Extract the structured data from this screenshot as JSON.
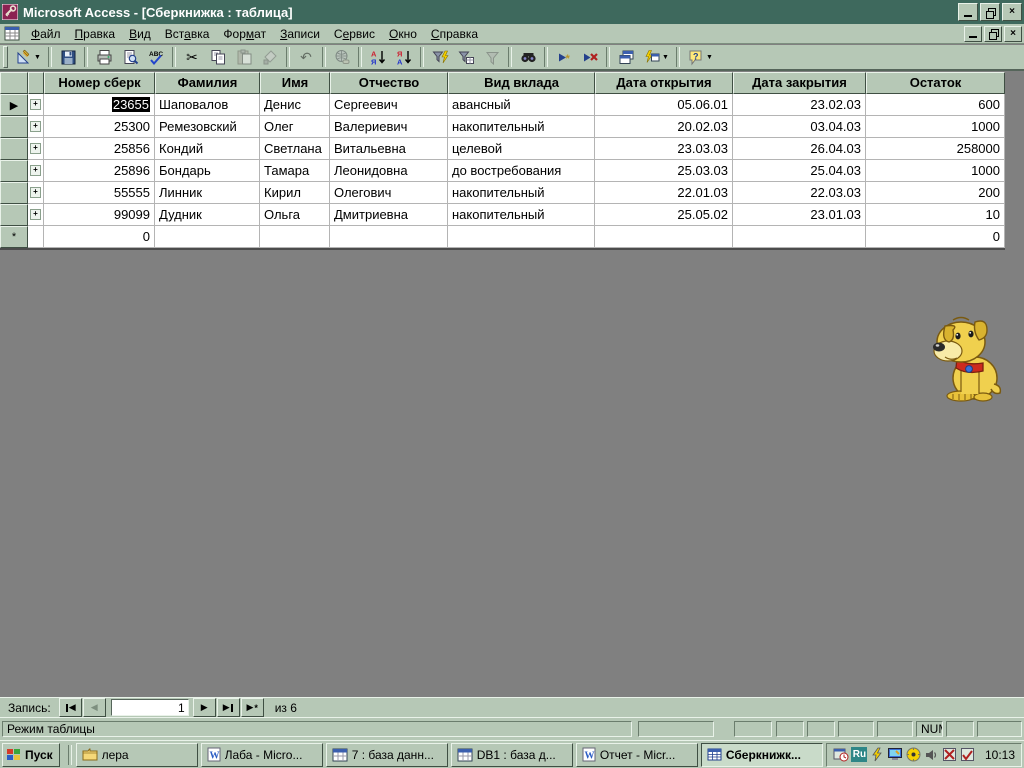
{
  "window": {
    "title": "Microsoft Access - [Сберкнижка : таблица]"
  },
  "menu": {
    "items": [
      {
        "label": "Файл",
        "u": 0
      },
      {
        "label": "Правка",
        "u": 0
      },
      {
        "label": "Вид",
        "u": 0
      },
      {
        "label": "Вставка",
        "u": 3
      },
      {
        "label": "Формат",
        "u": 3
      },
      {
        "label": "Записи",
        "u": 0
      },
      {
        "label": "Сервис",
        "u": 1
      },
      {
        "label": "Окно",
        "u": 0
      },
      {
        "label": "Справка",
        "u": 0
      }
    ]
  },
  "toolbar": {
    "buttons": [
      {
        "icon": "design-view-icon",
        "name": "view-button",
        "dropdown": true
      },
      {
        "sep": true
      },
      {
        "icon": "save-icon",
        "name": "save-button"
      },
      {
        "sep": true
      },
      {
        "icon": "print-icon",
        "name": "print-button"
      },
      {
        "icon": "print-preview-icon",
        "name": "print-preview-button"
      },
      {
        "icon": "spelling-icon",
        "name": "spelling-button"
      },
      {
        "sep": true
      },
      {
        "icon": "cut-icon",
        "name": "cut-button",
        "glyph": "✂"
      },
      {
        "icon": "copy-icon",
        "name": "copy-button"
      },
      {
        "icon": "paste-icon",
        "name": "paste-button",
        "disabled": true
      },
      {
        "icon": "format-painter-icon",
        "name": "format-painter-button",
        "disabled": true
      },
      {
        "sep": true
      },
      {
        "icon": "undo-icon",
        "name": "undo-button",
        "glyph": "↶",
        "disabled": true
      },
      {
        "sep": true
      },
      {
        "icon": "hyperlink-icon",
        "name": "insert-hyperlink-button",
        "disabled": true
      },
      {
        "sep": true
      },
      {
        "icon": "sort-asc-icon",
        "name": "sort-ascending-button"
      },
      {
        "icon": "sort-desc-icon",
        "name": "sort-descending-button"
      },
      {
        "sep": true
      },
      {
        "icon": "filter-selection-icon",
        "name": "filter-by-selection-button"
      },
      {
        "icon": "filter-form-icon",
        "name": "filter-by-form-button"
      },
      {
        "icon": "apply-filter-icon",
        "name": "apply-filter-button",
        "disabled": true
      },
      {
        "sep": true
      },
      {
        "icon": "find-icon",
        "name": "find-button"
      },
      {
        "sep": true
      },
      {
        "icon": "new-record-icon",
        "name": "new-record-button"
      },
      {
        "icon": "delete-record-icon",
        "name": "delete-record-button"
      },
      {
        "sep": true
      },
      {
        "icon": "database-window-icon",
        "name": "database-window-button"
      },
      {
        "icon": "new-object-icon",
        "name": "new-object-button",
        "dropdown": true
      },
      {
        "sep": true
      },
      {
        "icon": "help-icon",
        "name": "help-button",
        "dropdown": true
      }
    ]
  },
  "table": {
    "columns": [
      {
        "key": "num",
        "label": "Номер сберк",
        "align": "right"
      },
      {
        "key": "last",
        "label": "Фамилия",
        "align": "left"
      },
      {
        "key": "first",
        "label": "Имя",
        "align": "left"
      },
      {
        "key": "mid",
        "label": "Отчество",
        "align": "left"
      },
      {
        "key": "type",
        "label": "Вид вклада",
        "align": "left"
      },
      {
        "key": "open",
        "label": "Дата открытия",
        "align": "right"
      },
      {
        "key": "close",
        "label": "Дата закрытия",
        "align": "right"
      },
      {
        "key": "bal",
        "label": "Остаток",
        "align": "right"
      }
    ],
    "rows": [
      {
        "num": "23655",
        "last": "Шаповалов",
        "first": "Денис",
        "mid": "Сергеевич",
        "type": "авансный",
        "open": "05.06.01",
        "close": "23.02.03",
        "bal": "600",
        "current": true,
        "selected_cell": "num"
      },
      {
        "num": "25300",
        "last": "Ремезовский",
        "first": "Олег",
        "mid": "Валериевич",
        "type": "накопительный",
        "open": "20.02.03",
        "close": "03.04.03",
        "bal": "1000"
      },
      {
        "num": "25856",
        "last": "Кондий",
        "first": "Светлана",
        "mid": "Витальевна",
        "type": "целевой",
        "open": "23.03.03",
        "close": "26.04.03",
        "bal": "258000"
      },
      {
        "num": "25896",
        "last": "Бондарь",
        "first": "Тамара",
        "mid": "Леонидовна",
        "type": "до востребования",
        "open": "25.03.03",
        "close": "25.04.03",
        "bal": "1000"
      },
      {
        "num": "55555",
        "last": "Линник",
        "first": "Кирил",
        "mid": "Олегович",
        "type": "накопительный",
        "open": "22.01.03",
        "close": "22.03.03",
        "bal": "200"
      },
      {
        "num": "99099",
        "last": "Дудник",
        "first": "Ольга",
        "mid": "Дмитриевна",
        "type": "накопительный",
        "open": "25.05.02",
        "close": "23.01.03",
        "bal": "10"
      }
    ],
    "new_row": {
      "num": "0",
      "bal": "0",
      "marker": "*"
    },
    "current_row_marker": "▶"
  },
  "record_nav": {
    "label": "Запись:",
    "value": "1",
    "count_label": "из 6"
  },
  "status": {
    "left": "Режим таблицы",
    "num": "NUM"
  },
  "taskbar": {
    "start_label": "Пуск",
    "items": [
      {
        "icon": "folder-icon",
        "label": "лера"
      },
      {
        "icon": "word-icon",
        "label": "Лаба - Micro..."
      },
      {
        "icon": "access-icon",
        "label": "7 : база данн..."
      },
      {
        "icon": "access-icon",
        "label": "DB1 : база д..."
      },
      {
        "icon": "word-icon",
        "label": "Отчет - Micr..."
      },
      {
        "icon": "datasheet-icon",
        "label": "Сберкнижк...",
        "active": true
      }
    ],
    "tray_icons": [
      {
        "name": "scheduler-icon"
      },
      {
        "name": "lang-indicator",
        "text": "Ru"
      },
      {
        "name": "flash-icon"
      },
      {
        "name": "display-icon"
      },
      {
        "name": "volume-icon"
      },
      {
        "name": "speaker-icon"
      },
      {
        "name": "tool-icon"
      },
      {
        "name": "mail-check-icon"
      }
    ],
    "clock": "10:13"
  },
  "colors": {
    "titlebar": "#3e695d",
    "face": "#b6c8b6",
    "workspace": "#808080",
    "selection_bg": "#000000",
    "selection_fg": "#ffffff",
    "lang_indicator_bg": "#2e8687"
  },
  "icons": {
    "minimize": "_",
    "restore": "❐",
    "close": "×",
    "nav_prev": "◀",
    "nav_next": "▶"
  }
}
